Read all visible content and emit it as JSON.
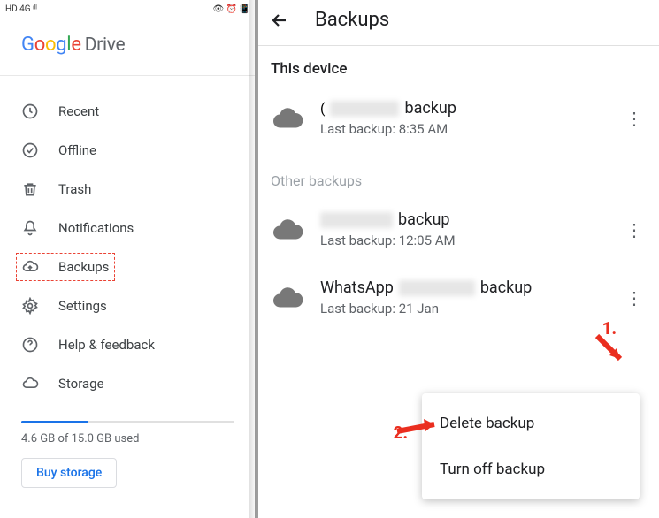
{
  "status_bar": {
    "left": "HD 4G ᶦˡˡ",
    "right": "👁 ⏰ 📳"
  },
  "logo": {
    "g": "G",
    "o1": "o",
    "o2": "o",
    "g2": "g",
    "l": "l",
    "e": "e",
    "drive": "Drive"
  },
  "nav": {
    "recent": "Recent",
    "offline": "Offline",
    "trash": "Trash",
    "notifications": "Notifications",
    "backups": "Backups",
    "settings": "Settings",
    "help": "Help & feedback",
    "storage": "Storage"
  },
  "storage": {
    "text": "4.6 GB of 15.0 GB used",
    "percent": 31,
    "buy": "Buy storage"
  },
  "header": {
    "title": "Backups"
  },
  "sections": {
    "this_device": "This device",
    "other": "Other backups"
  },
  "backups": {
    "item1": {
      "suffix": "backup",
      "sub": "Last backup: 8:35 AM"
    },
    "item2": {
      "suffix": "backup",
      "sub": "Last backup: 12:05 AM"
    },
    "item3": {
      "prefix": "WhatsApp",
      "suffix": "backup",
      "sub": "Last backup: 21 Jan"
    }
  },
  "popup": {
    "delete": "Delete backup",
    "turn_off": "Turn off backup"
  },
  "annotations": {
    "a1": "1.",
    "a2": "2."
  }
}
